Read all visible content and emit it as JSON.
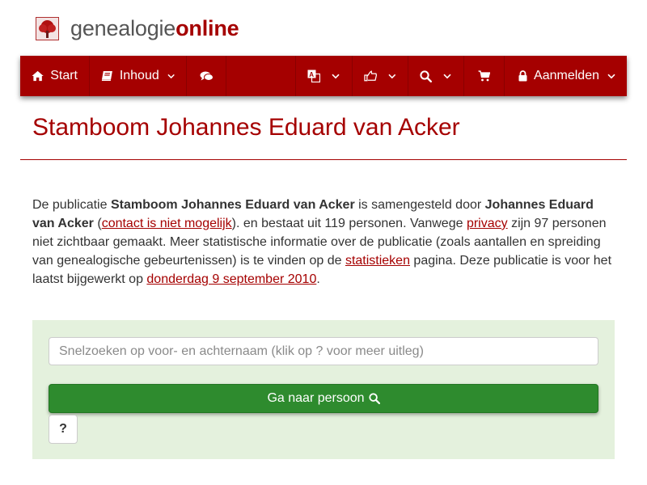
{
  "brand": {
    "part1": "genealogie",
    "part2": "online"
  },
  "nav": {
    "start": {
      "label": "Start",
      "icon": "home-icon"
    },
    "inhoud": {
      "label": "Inhoud",
      "icon": "book-icon"
    },
    "chat": {
      "icon": "comments-icon"
    },
    "language": {
      "icon": "translate-icon"
    },
    "share": {
      "icon": "share-icon"
    },
    "search": {
      "icon": "search-icon"
    },
    "cart": {
      "icon": "cart-icon"
    },
    "login": {
      "label": "Aanmelden",
      "icon": "lock-icon"
    }
  },
  "page": {
    "title": "Stamboom Johannes Eduard van Acker"
  },
  "intro": {
    "t1": "De publicatie ",
    "pub_name": "Stamboom Johannes Eduard van Acker",
    "t2": " is samengesteld door ",
    "author": "Johannes Eduard van Acker",
    "t3": " (",
    "contact_link": "contact is niet mogelijk",
    "t4": "). en bestaat uit 119 personen. Vanwege ",
    "privacy_link": "privacy",
    "t5": " zijn 97 personen niet zichtbaar gemaakt. Meer statistische informatie over de publicatie (zoals aantallen en spreiding van genealogische gebeurtenissen) is te vinden op de ",
    "stats_link": "statistieken",
    "t6": " pagina. Deze publicatie is voor het laatst bijgewerkt op ",
    "date_link": "donderdag 9 september 2010",
    "t7": "."
  },
  "search": {
    "placeholder": "Snelzoeken op voor- en achternaam (klik op ? voor meer uitleg)",
    "go_label": "Ga naar persoon",
    "help_label": "?"
  },
  "colors": {
    "brand_red": "#a50000",
    "panel_green": "#e4f1dd",
    "button_green": "#2e8b2e"
  }
}
